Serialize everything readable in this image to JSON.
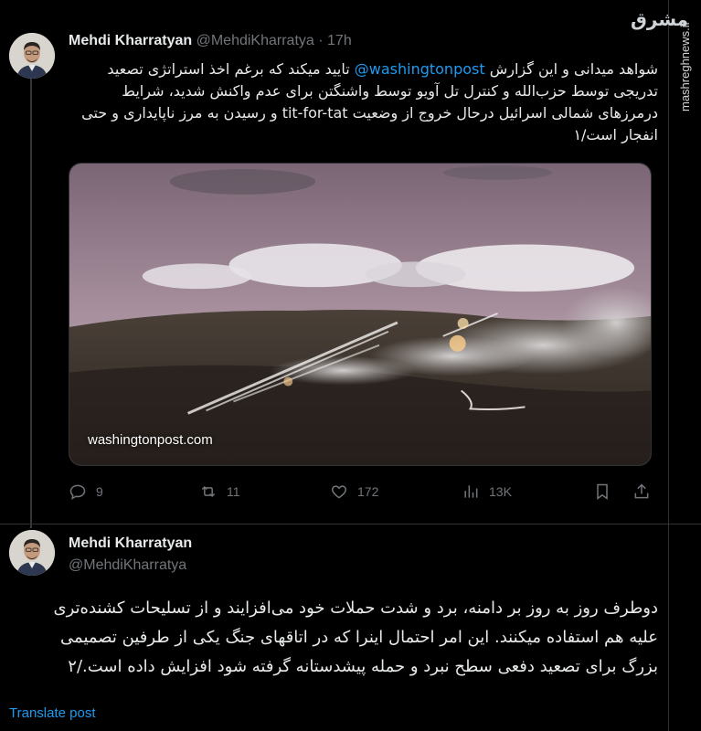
{
  "tweet1": {
    "author_name": "Mehdi Kharratyan",
    "handle": "@MehdiKharratya",
    "separator": "·",
    "time": "17h",
    "text_before_mention": "شواهد میدانی و این گزارش ",
    "mention": "@washingtonpost",
    "text_after_mention": " تایید میکند که برغم اخذ استراتژی تصعید تدریجی توسط حزب‌الله و کنترل تل آویو توسط واشنگتن برای عدم واکنش شدید، شرایط درمرزهای شمالی اسرائیل درحال خروج از وضعیت tit-for-tat و رسیدن به مرز ناپایداری و حتی انفجار است/۱",
    "media_caption": "washingtonpost.com",
    "stats": {
      "replies": "9",
      "retweets": "11",
      "likes": "172",
      "views": "13K"
    }
  },
  "tweet2": {
    "author_name": "Mehdi Kharratyan",
    "handle": "@MehdiKharratya",
    "text": "دوطرف روز به روز بر دامنه، برد و شدت حملات خود می‌افزایند و از تسلیحات کشنده‌تری علیه هم استفاده میکنند. این امر احتمال اینرا که در اتاقهای جنگ یکی از طرفین تصمیمی بزرگ برای تصعید دفعی سطح  نبرد و حمله پیشدستانه گرفته شود افزایش داده است./۲",
    "translate_link": "Translate post"
  },
  "watermark": {
    "logo_text": "مشرق",
    "site": "mashreghnews.ir"
  },
  "colors": {
    "background": "#000000",
    "text": "#e7e9ea",
    "muted": "#71767b",
    "accent": "#1d9bf0",
    "border": "#2f3336"
  },
  "icons": [
    "reply-icon",
    "retweet-icon",
    "like-icon",
    "views-icon",
    "bookmark-icon",
    "share-icon"
  ]
}
